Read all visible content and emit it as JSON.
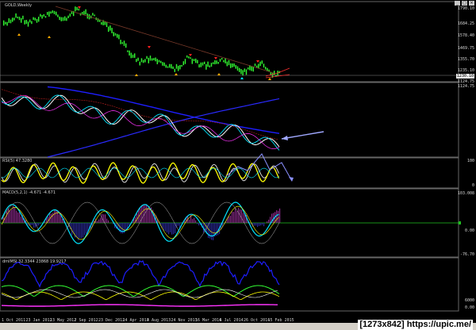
{
  "panes": {
    "price": {
      "label": "GOLD,Weekly",
      "axis": [
        "1790.10",
        "1684.25",
        "1578.40",
        "1469.75",
        "1355.70",
        "1235.10",
        "1124.75"
      ],
      "last_price": "1230.10"
    },
    "channel": {
      "axis": [
        "1124.75"
      ]
    },
    "rsi": {
      "label": "RSI(5) 47.3280",
      "axis": [
        "100",
        "0"
      ]
    },
    "macd": {
      "label": "MACD(5,2,1) -4.671 -4.671",
      "axis": [
        "103.008",
        "0.00",
        "-76.70"
      ]
    },
    "dmi": {
      "label": "dmIMSI 32.3344 23868 19.9217",
      "axis": [
        "6000",
        "0.00"
      ]
    }
  },
  "dates": [
    "1 Oct 2011",
    "23 Jan 2012",
    "13 May 2012",
    "2 Sep 2012",
    "23 Dec 2012",
    "14 Apr 2013",
    "4 Aug 2013",
    "24 Nov 2013",
    "16 Mar 2014",
    "6 Jul 2014",
    "26 Oct 2014",
    "15 Feb 2015"
  ],
  "window_buttons": [
    "_",
    "□",
    "×"
  ],
  "watermark": "[1273x842] https://upic.me/",
  "colors": {
    "candles": "#32ff32",
    "up_arrow": "#ffae00",
    "down_arrow": "#ff2020",
    "ma_blue": "#1e1eff",
    "cyan": "#00e5ff",
    "yellow": "#ffff00",
    "magenta": "#ff33ff",
    "annotation": "#a0a8ff"
  }
}
